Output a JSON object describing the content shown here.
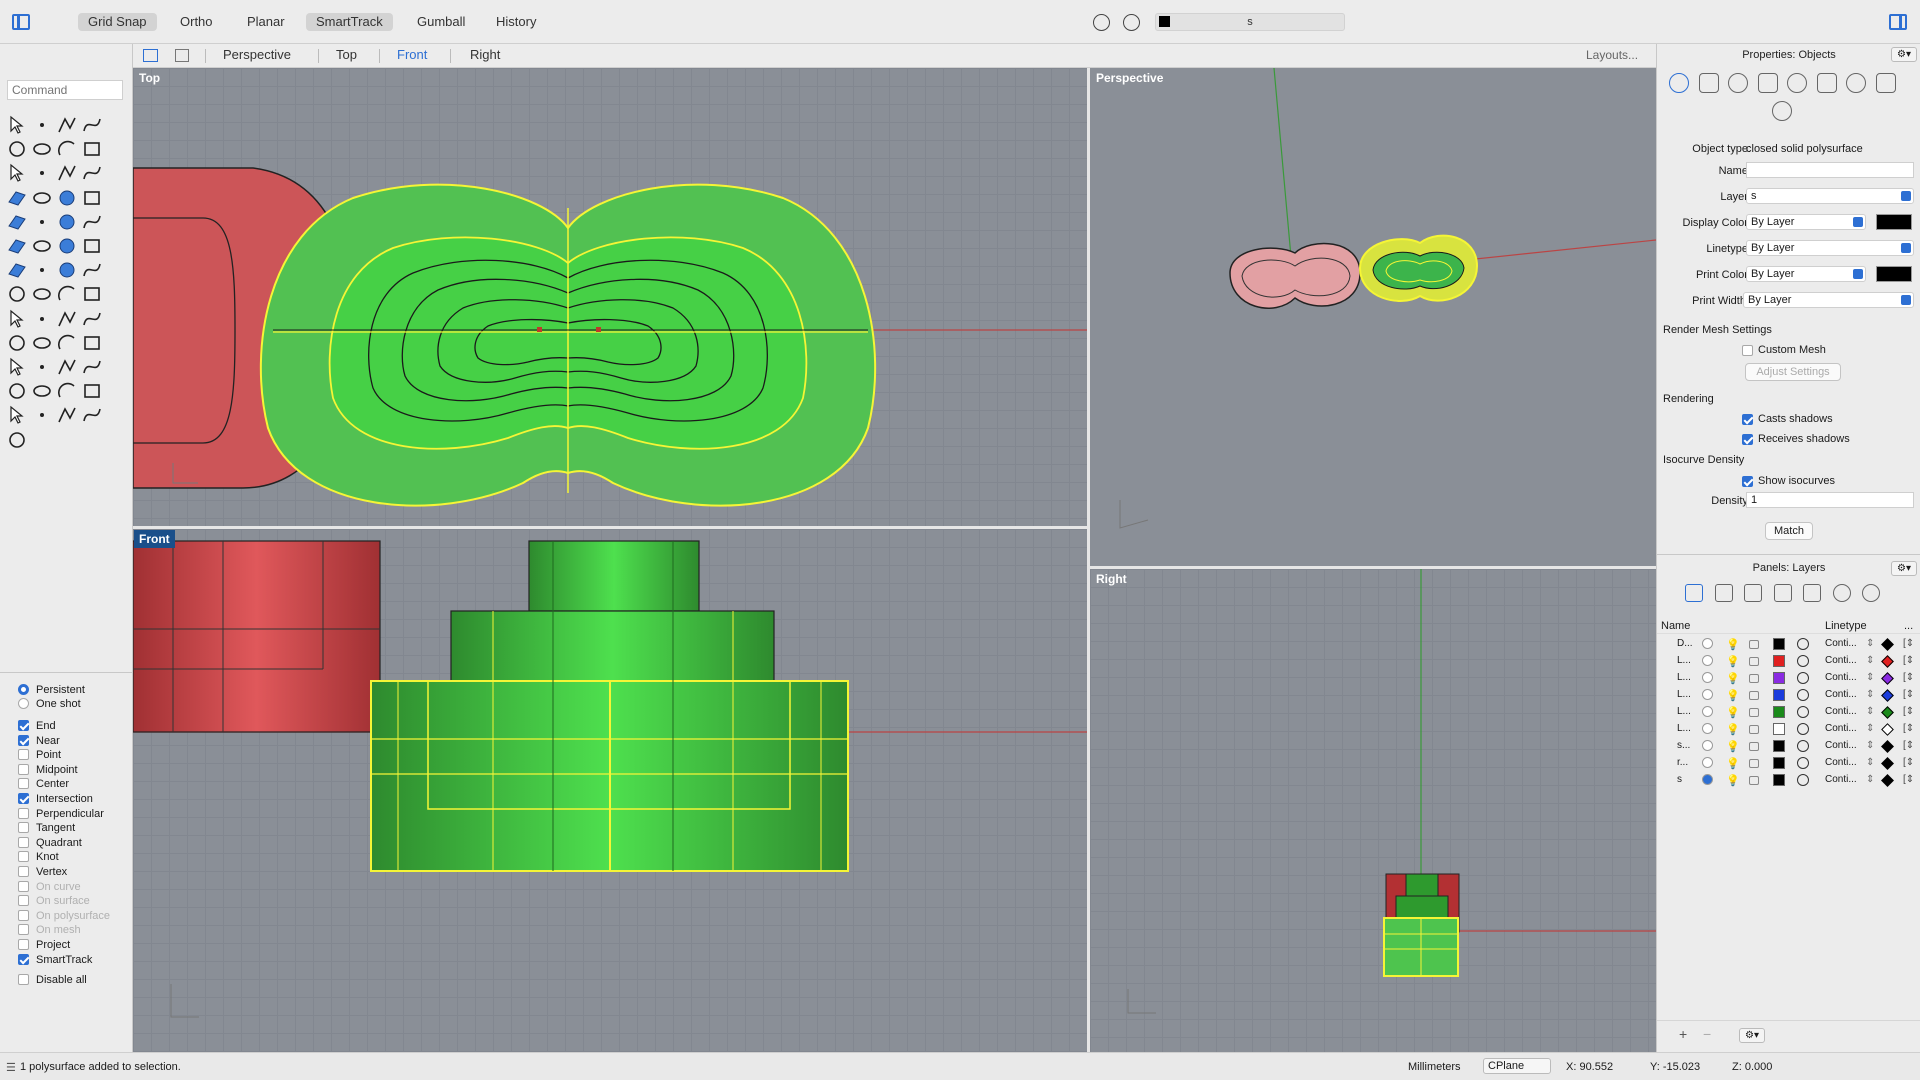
{
  "toolbar": {
    "buttons": [
      "Grid Snap",
      "Ortho",
      "Planar",
      "SmartTrack",
      "Gumball",
      "History"
    ],
    "layer_name": "s"
  },
  "command": {
    "placeholder": "Command"
  },
  "viewport_tabs": [
    "Perspective",
    "Top",
    "Front",
    "Right"
  ],
  "layouts_label": "Layouts...",
  "viewports": {
    "top": "Top",
    "perspective": "Perspective",
    "front": "Front",
    "right": "Right"
  },
  "osnap": {
    "mode": [
      "Persistent",
      "One shot"
    ],
    "items": [
      {
        "label": "End",
        "checked": true,
        "enabled": true
      },
      {
        "label": "Near",
        "checked": true,
        "enabled": true
      },
      {
        "label": "Point",
        "checked": false,
        "enabled": true
      },
      {
        "label": "Midpoint",
        "checked": false,
        "enabled": true
      },
      {
        "label": "Center",
        "checked": false,
        "enabled": true
      },
      {
        "label": "Intersection",
        "checked": true,
        "enabled": true
      },
      {
        "label": "Perpendicular",
        "checked": false,
        "enabled": true
      },
      {
        "label": "Tangent",
        "checked": false,
        "enabled": true
      },
      {
        "label": "Quadrant",
        "checked": false,
        "enabled": true
      },
      {
        "label": "Knot",
        "checked": false,
        "enabled": true
      },
      {
        "label": "Vertex",
        "checked": false,
        "enabled": true
      },
      {
        "label": "On curve",
        "checked": false,
        "enabled": false
      },
      {
        "label": "On surface",
        "checked": false,
        "enabled": false
      },
      {
        "label": "On polysurface",
        "checked": false,
        "enabled": false
      },
      {
        "label": "On mesh",
        "checked": false,
        "enabled": false
      },
      {
        "label": "Project",
        "checked": false,
        "enabled": true
      },
      {
        "label": "SmartTrack",
        "checked": true,
        "enabled": true
      }
    ],
    "disable_all": "Disable all"
  },
  "properties": {
    "title": "Properties: Objects",
    "object_type_label": "Object type:",
    "object_type": "closed solid polysurface",
    "name_label": "Name:",
    "name_value": "",
    "layer_label": "Layer:",
    "layer_value": "s",
    "display_color_label": "Display Color:",
    "display_color_value": "By Layer",
    "linetype_label": "Linetype:",
    "linetype_value": "By Layer",
    "print_color_label": "Print Color:",
    "print_color_value": "By Layer",
    "print_width_label": "Print Width:",
    "print_width_value": "By Layer",
    "render_mesh_title": "Render Mesh Settings",
    "custom_mesh": "Custom Mesh",
    "adjust_settings": "Adjust Settings",
    "rendering_title": "Rendering",
    "casts_shadows": "Casts shadows",
    "receives_shadows": "Receives shadows",
    "isocurve_title": "Isocurve Density",
    "show_isocurves": "Show isocurves",
    "density_label": "Density:",
    "density_value": "1",
    "match": "Match"
  },
  "layers": {
    "title": "Panels: Layers",
    "col_name": "Name",
    "col_linetype": "Linetype",
    "col_more": "...",
    "rows": [
      {
        "name": "D...",
        "color": "#000000",
        "material": "#000000",
        "current": false
      },
      {
        "name": "L...",
        "color": "#e02020",
        "material": "#e02020",
        "current": false
      },
      {
        "name": "L...",
        "color": "#8a2be2",
        "material": "#8a2be2",
        "current": false
      },
      {
        "name": "L...",
        "color": "#1a3cdc",
        "material": "#1a3cdc",
        "current": false
      },
      {
        "name": "L...",
        "color": "#1a8a1a",
        "material": "#1a8a1a",
        "current": false
      },
      {
        "name": "L...",
        "color": "#ffffff",
        "material": "#ffffff",
        "current": false
      },
      {
        "name": "s...",
        "color": "#000000",
        "material": "#000000",
        "current": false
      },
      {
        "name": "r...",
        "color": "#000000",
        "material": "#000000",
        "current": false
      },
      {
        "name": "s",
        "color": "#000000",
        "material": "#000000",
        "current": true
      }
    ],
    "linetype_value": "Conti..."
  },
  "status": {
    "message": "1 polysurface added to selection.",
    "units": "Millimeters",
    "cplane": "CPlane",
    "x": "X: 90.552",
    "y": "Y: -15.023",
    "z": "Z: 0.000"
  },
  "colors": {
    "accent": "#2d6fd3",
    "green": "#3ccf3c",
    "red": "#cc4f52",
    "yellow": "#f0f020"
  }
}
